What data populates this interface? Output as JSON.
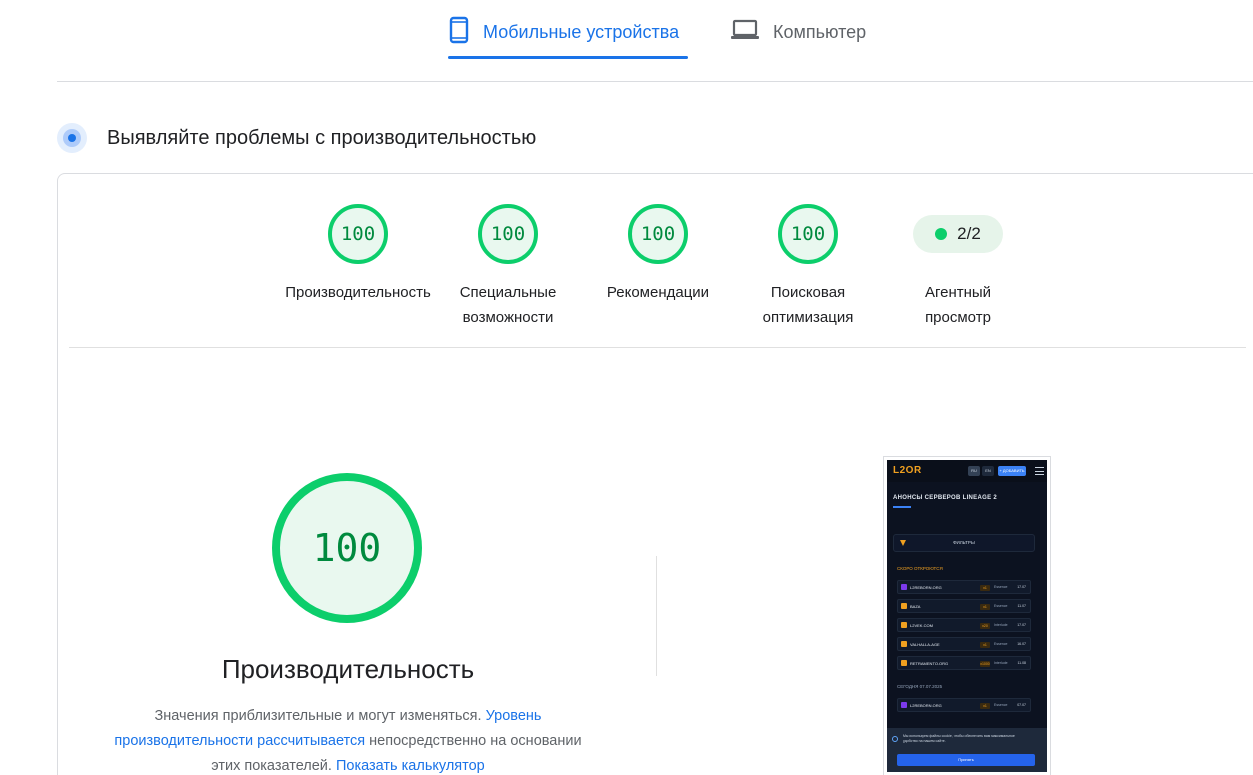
{
  "tabs": {
    "mobile_label": "Мобильные устройства",
    "desktop_label": "Компьютер",
    "active": "mobile"
  },
  "section": {
    "title": "Выявляйте проблемы с производительностью"
  },
  "scores": [
    {
      "value": "100",
      "label": "Производительность"
    },
    {
      "value": "100",
      "label": "Специальные\nвозможности"
    },
    {
      "value": "100",
      "label": "Рекомендации"
    },
    {
      "value": "100",
      "label": "Поисковая\nоптимизация"
    }
  ],
  "agent": {
    "value": "2/2",
    "label": "Агентный\nпросмотр"
  },
  "performance": {
    "score": "100",
    "title": "Производительность",
    "desc_text1": "Значения приблизительные и могут изменяться. ",
    "desc_link1": "Уровень производительности рассчитывается",
    "desc_text2": " непосредственно на основании этих показателей. ",
    "desc_link2": "Показать калькулятор"
  },
  "phone": {
    "logo": "L2OR",
    "chip1": "RU",
    "chip2": "EN",
    "chip3": "+ ДОБАВИТЬ",
    "heading": "АНОНСЫ СЕРВЕРОВ LINEAGE 2",
    "filter_label": "ФИЛЬТРЫ",
    "section_soon": "СКОРО ОТКРОЮТСЯ",
    "section_today": "СЕГОДНЯ",
    "section_today_date": "07.07.2025",
    "rows": [
      {
        "name": "L2REBORN.ORG",
        "tag": "x1",
        "rate": "Essence",
        "date": "17.07"
      },
      {
        "name": "BAZA",
        "tag": "x1",
        "rate": "Essence",
        "date": "11.07"
      },
      {
        "name": "L2VEK.COM",
        "tag": "x20",
        "rate": "Interlude",
        "date": "17.07"
      },
      {
        "name": "VALHALLA-AGE",
        "tag": "x1",
        "rate": "Essence",
        "date": "16.07"
      },
      {
        "name": "RETRAMENTO.ORG",
        "tag": "x1000",
        "rate": "Interlude",
        "date": "11.08"
      }
    ],
    "today_rows": [
      {
        "name": "L2REBORN.ORG",
        "tag": "x1",
        "rate": "Essence",
        "date": "07.07"
      }
    ],
    "cookie_text": "Мы используем файлы cookie, чтобы обеспечить вам максимальное удобство на нашем сайте.",
    "cookie_button": "Принять"
  },
  "colors": {
    "accent": "#1a73e8",
    "pass": "#0cce6b",
    "pass_text": "#008a3e"
  }
}
